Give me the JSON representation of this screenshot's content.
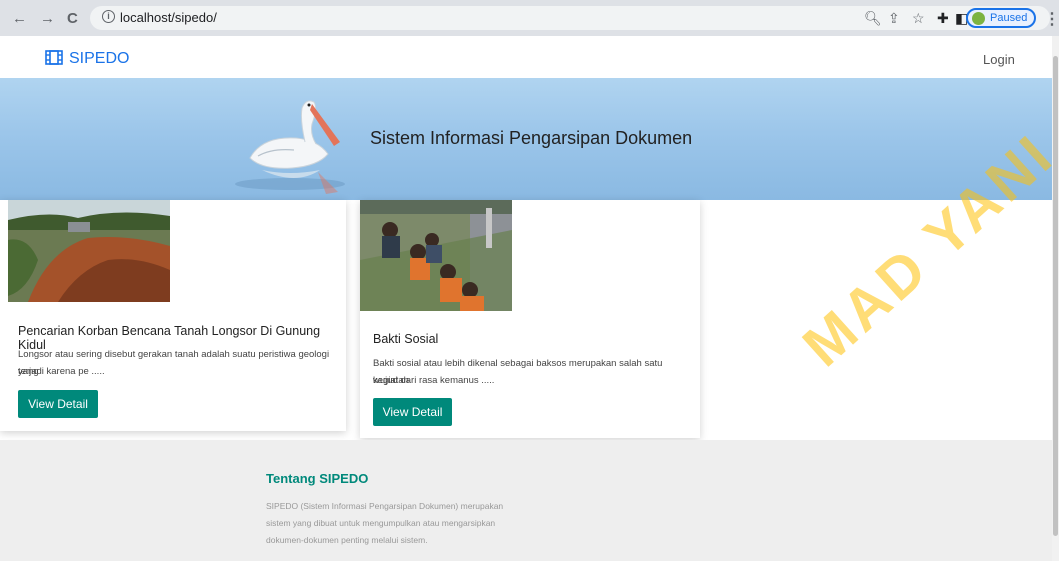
{
  "browser": {
    "url": "localhost/sipedo/",
    "paused_label": "Paused"
  },
  "nav": {
    "brand": "SIPEDO",
    "login": "Login"
  },
  "hero": {
    "title": "Sistem Informasi Pengarsipan Dokumen"
  },
  "cards": [
    {
      "title": "Pencarian Korban Bencana Tanah Longsor Di Gunung Kidul",
      "text_line1": "Longsor atau sering disebut gerakan tanah adalah suatu peristiwa geologi yang",
      "text_line2": "terjadi karena pe .....",
      "button": "View Detail"
    },
    {
      "title": "Bakti Sosial",
      "text_line1": "Bakti sosial atau lebih dikenal sebagai baksos merupakan salah satu kegiatan",
      "text_line2": "wujud dari rasa kemanus .....",
      "button": "View Detail"
    }
  ],
  "footer": {
    "title": "Tentang SIPEDO",
    "line1": "SIPEDO (Sistem Informasi Pengarsipan Dokumen) merupakan",
    "line2": "sistem yang dibuat untuk mengumpulkan atau mengarsipkan",
    "line3": "dokumen-dokumen penting melalui sistem."
  },
  "watermark": "MAD YANI",
  "colors": {
    "brand": "#1a73e8",
    "button": "#00897b",
    "footer_bg": "#eeeeee"
  }
}
